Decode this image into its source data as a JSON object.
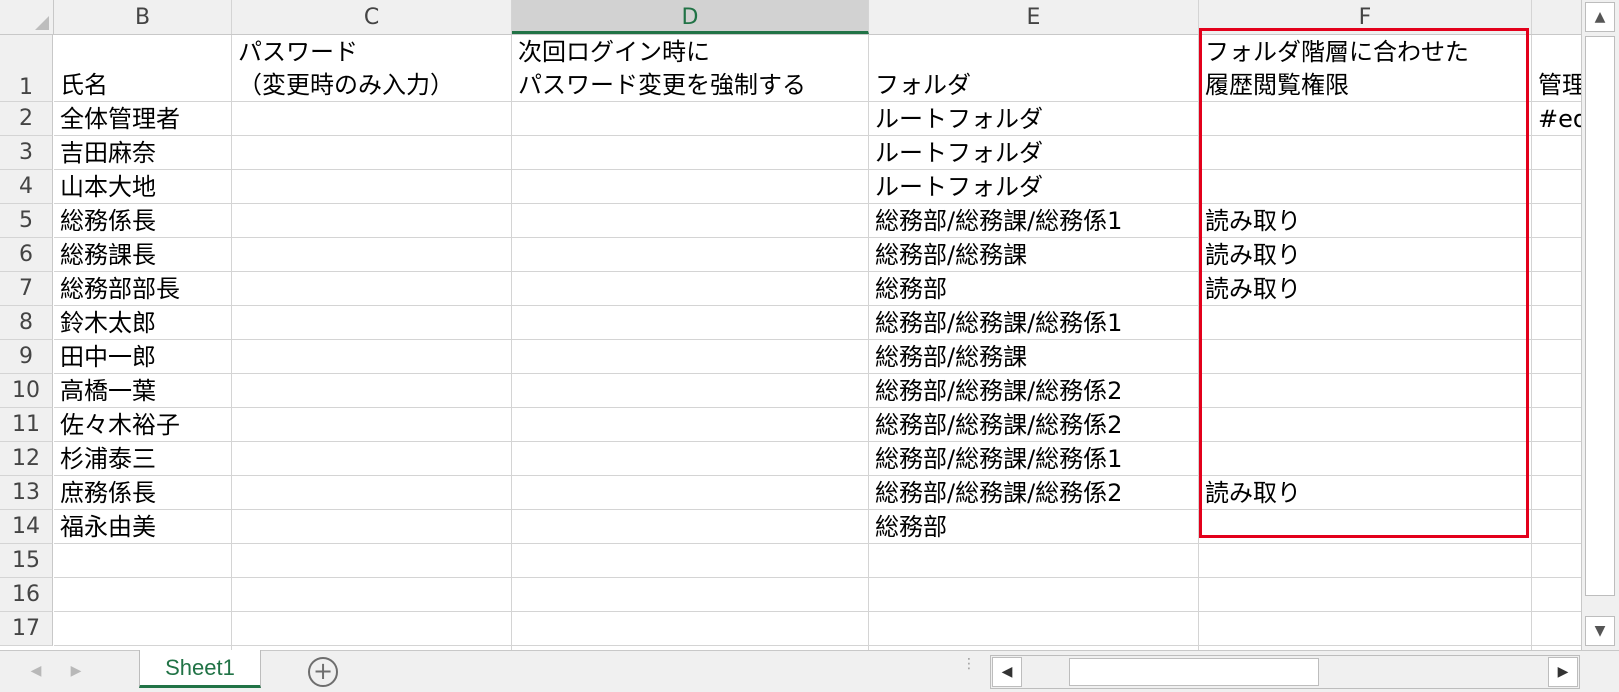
{
  "columns": [
    "B",
    "C",
    "D",
    "E",
    "F"
  ],
  "selected_column": "D",
  "row_numbers": [
    "1",
    "2",
    "3",
    "4",
    "5",
    "6",
    "7",
    "8",
    "9",
    "10",
    "11",
    "12",
    "13",
    "14",
    "15",
    "16",
    "17"
  ],
  "header_row": {
    "b": "氏名",
    "c_line1": "パスワード",
    "c_line2": "（変更時のみ入力）",
    "d_line1": "次回ログイン時に",
    "d_line2": "パスワード変更を強制する",
    "e": "フォルダ",
    "f_line1": "フォルダ階層に合わせた",
    "f_line2": "履歴閲覧権限",
    "g_partial": "管理"
  },
  "rows": [
    {
      "name": "全体管理者",
      "folder": "ルートフォルダ",
      "permission": "",
      "extra": "#ed"
    },
    {
      "name": "吉田麻奈",
      "folder": "ルートフォルダ",
      "permission": "",
      "extra": ""
    },
    {
      "name": "山本大地",
      "folder": "ルートフォルダ",
      "permission": "",
      "extra": ""
    },
    {
      "name": "総務係長",
      "folder": "総務部/総務課/総務係1",
      "permission": "読み取り",
      "extra": ""
    },
    {
      "name": "総務課長",
      "folder": "総務部/総務課",
      "permission": "読み取り",
      "extra": ""
    },
    {
      "name": "総務部部長",
      "folder": "総務部",
      "permission": "読み取り",
      "extra": ""
    },
    {
      "name": "鈴木太郎",
      "folder": "総務部/総務課/総務係1",
      "permission": "",
      "extra": ""
    },
    {
      "name": "田中一郎",
      "folder": "総務部/総務課",
      "permission": "",
      "extra": ""
    },
    {
      "name": "高橋一葉",
      "folder": "総務部/総務課/総務係2",
      "permission": "",
      "extra": ""
    },
    {
      "name": "佐々木裕子",
      "folder": "総務部/総務課/総務係2",
      "permission": "",
      "extra": ""
    },
    {
      "name": "杉浦泰三",
      "folder": "総務部/総務課/総務係1",
      "permission": "",
      "extra": ""
    },
    {
      "name": "庶務係長",
      "folder": "総務部/総務課/総務係2",
      "permission": "読み取り",
      "extra": ""
    },
    {
      "name": "福永由美",
      "folder": "総務部",
      "permission": "",
      "extra": ""
    }
  ],
  "sheet_tab": "Sheet1",
  "icons": {
    "add_sheet": "plus-circle-icon",
    "scroll_up": "arrow-up-icon",
    "scroll_down": "arrow-down-icon",
    "scroll_left": "arrow-left-icon",
    "scroll_right": "arrow-right-icon"
  },
  "colors": {
    "accent": "#217346",
    "highlight_border": "#e3001b"
  }
}
